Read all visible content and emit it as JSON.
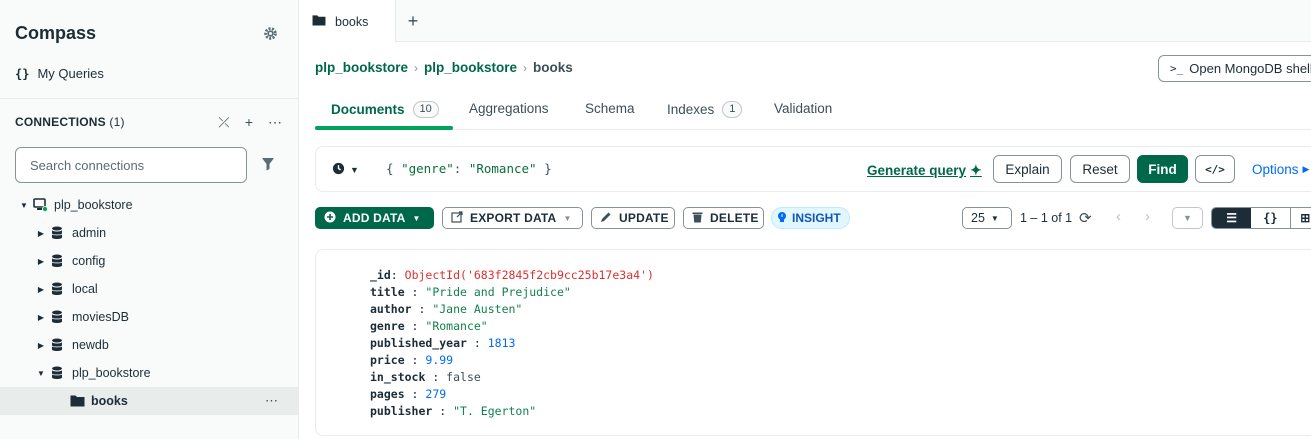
{
  "sidebar": {
    "app_title": "Compass",
    "my_queries": "My Queries",
    "my_queries_icon": "{}",
    "connections_label": "CONNECTIONS",
    "connections_count": "(1)",
    "search_placeholder": "Search connections",
    "tree": [
      {
        "label": "plp_bookstore",
        "icon": "connection-icon"
      },
      {
        "label": "admin",
        "icon": "database-icon"
      },
      {
        "label": "config",
        "icon": "database-icon"
      },
      {
        "label": "local",
        "icon": "database-icon"
      },
      {
        "label": "moviesDB",
        "icon": "database-icon"
      },
      {
        "label": "newdb",
        "icon": "database-icon"
      },
      {
        "label": "plp_bookstore",
        "icon": "database-icon"
      },
      {
        "label": "books",
        "icon": "folder-icon"
      }
    ]
  },
  "tabs": {
    "active_tab": "books"
  },
  "breadcrumb": {
    "items": [
      "plp_bookstore",
      "plp_bookstore",
      "books"
    ]
  },
  "shell_button": "Open MongoDB shell",
  "subtabs": [
    {
      "label": "Documents",
      "count": "10"
    },
    {
      "label": "Aggregations"
    },
    {
      "label": "Schema"
    },
    {
      "label": "Indexes",
      "count": "1"
    },
    {
      "label": "Validation"
    }
  ],
  "query": {
    "open_brace": "{",
    "key": "\"genre\"",
    "colon": ":",
    "value": "\"Romance\"",
    "close_brace": "}",
    "generate_query": "Generate query",
    "explain": "Explain",
    "reset": "Reset",
    "find": "Find",
    "options": "Options"
  },
  "toolbar": {
    "add_data": "ADD DATA",
    "export_data": "EXPORT DATA",
    "update": "UPDATE",
    "delete": "DELETE",
    "insight": "INSIGHT",
    "page_size": "25",
    "range": "1 – 1 of 1"
  },
  "document": [
    {
      "key": "_id",
      "value": "ObjectId('683f2845f2cb9cc25b17e3a4')",
      "type": "oid"
    },
    {
      "key": "title",
      "value": "\"Pride and Prejudice\"",
      "type": "str"
    },
    {
      "key": "author",
      "value": "\"Jane Austen\"",
      "type": "str"
    },
    {
      "key": "genre",
      "value": "\"Romance\"",
      "type": "str"
    },
    {
      "key": "published_year",
      "value": "1813",
      "type": "num"
    },
    {
      "key": "price",
      "value": "9.99",
      "type": "num"
    },
    {
      "key": "in_stock",
      "value": "false",
      "type": "bool"
    },
    {
      "key": "pages",
      "value": "279",
      "type": "num"
    },
    {
      "key": "publisher",
      "value": "\"T. Egerton\"",
      "type": "str"
    }
  ],
  "colors": {
    "brand_green": "#00684a",
    "accent_green": "#00a35c",
    "link_blue": "#016bf8",
    "oid_red": "#db3030"
  }
}
